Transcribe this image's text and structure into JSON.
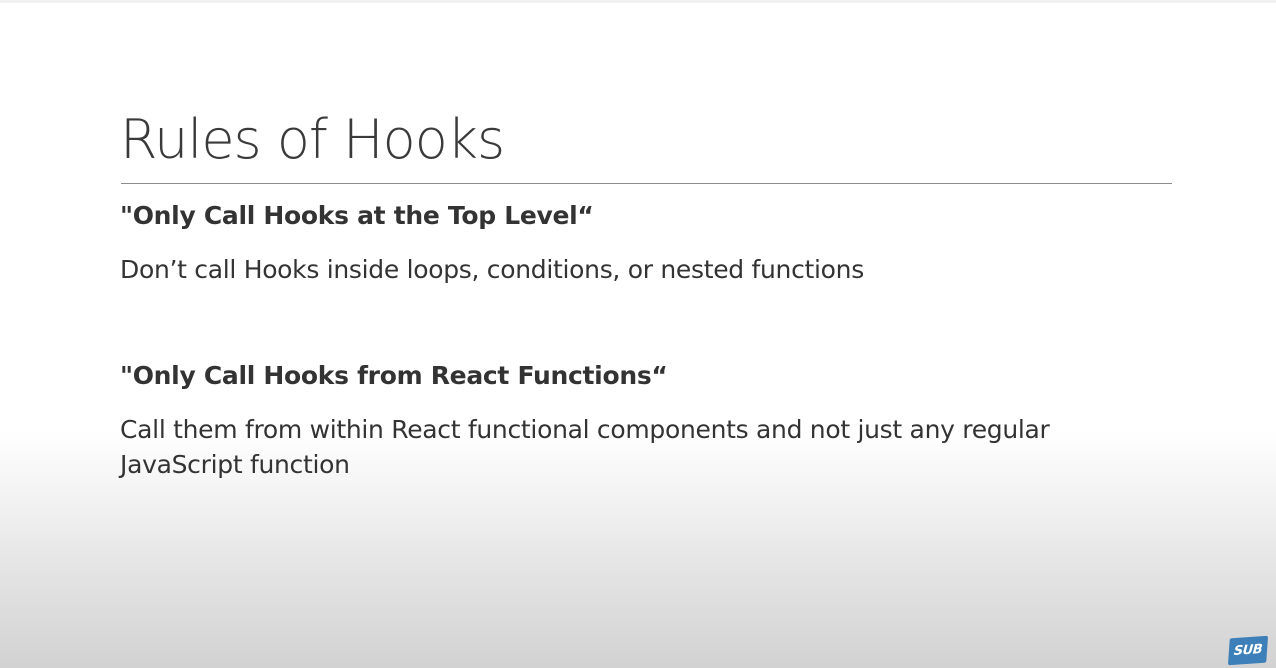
{
  "slide": {
    "title": "Rules of Hooks",
    "rules": [
      {
        "heading": "\"Only Call Hooks at the Top Level“",
        "text": "Don’t call Hooks inside loops, conditions, or nested functions"
      },
      {
        "heading": "\"Only Call Hooks from React Functions“",
        "text": "Call them from within React functional components and not just any regular JavaScript function"
      }
    ]
  },
  "badge": {
    "label": "SUB",
    "icon": "subscribe-badge-icon",
    "color": "#3d7fb8"
  },
  "colors": {
    "text": "#333333",
    "rule_line": "#8c8c8c"
  }
}
